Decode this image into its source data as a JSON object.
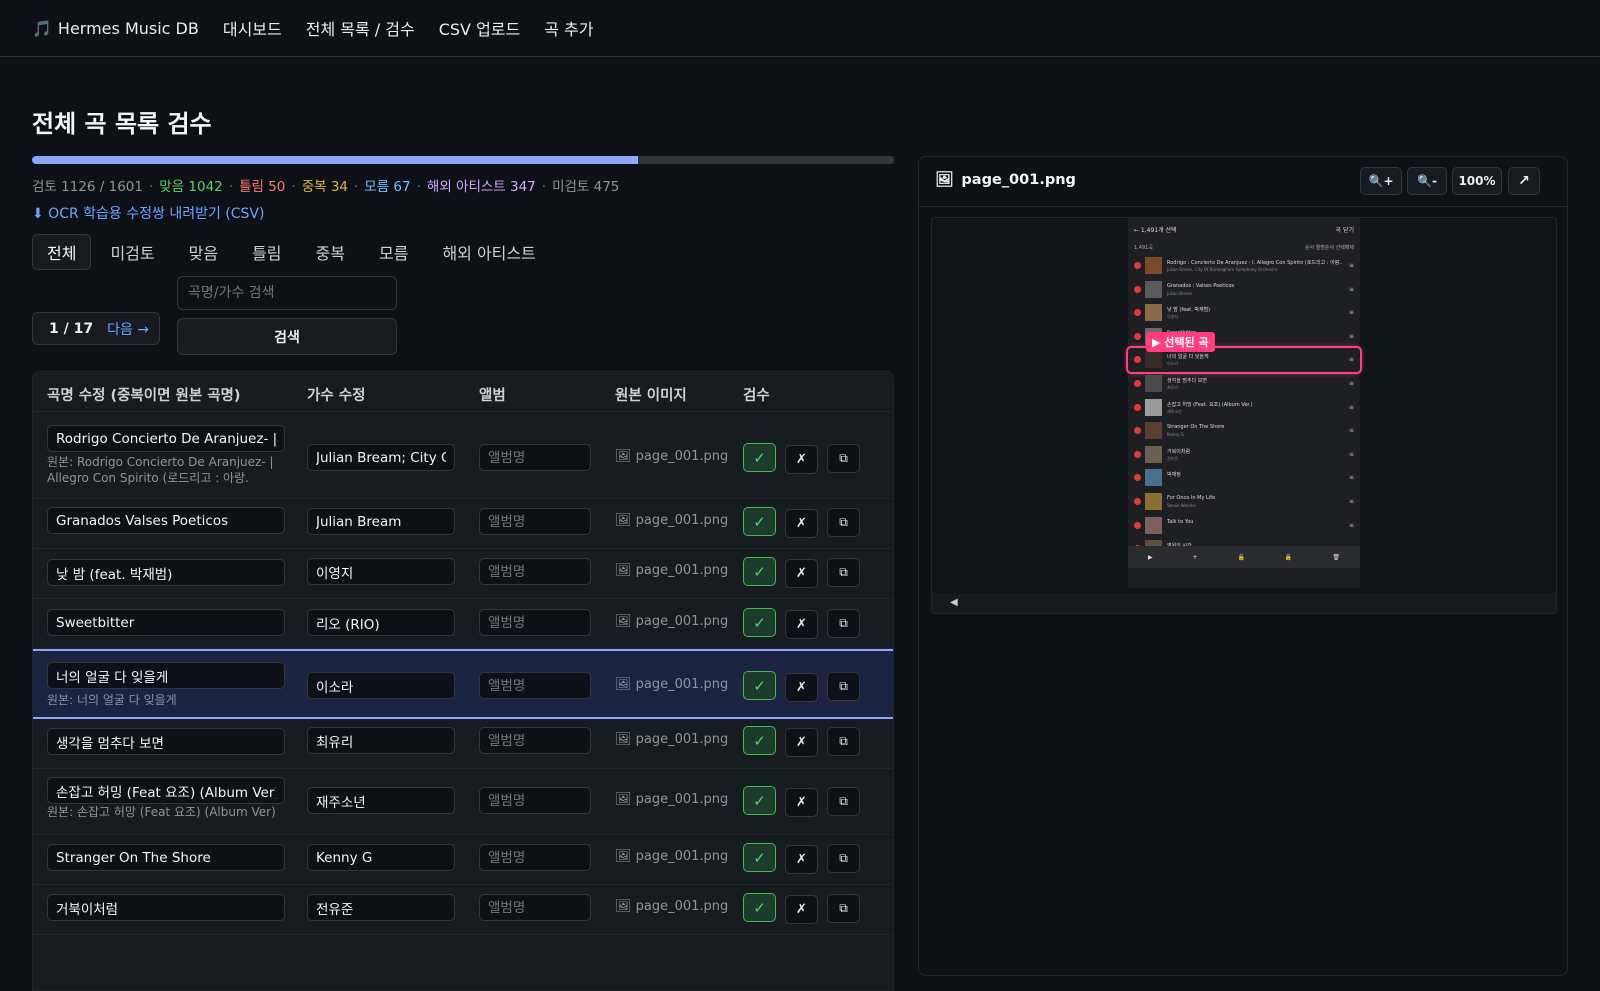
{
  "nav": {
    "brand_icon": "🎵",
    "brand": "Hermes Music DB",
    "links": [
      "대시보드",
      "전체 목록 / 검수",
      "CSV 업로드",
      "곡 추가"
    ]
  },
  "page": {
    "title": "전체 곡 목록 검수",
    "progress": 0.7033,
    "stats": {
      "review": "검토 1126 / 1601",
      "correct": "맞음 1042",
      "wrong": "틀림 50",
      "dup": "중복 34",
      "unknown": "모름 67",
      "foreign": "해외 아티스트 347",
      "unreviewed": "미검토 475"
    },
    "download_link": "⬇ OCR 학습용 수정쌍 내려받기 (CSV)",
    "filters": [
      "전체",
      "미검토",
      "맞음",
      "틀림",
      "중복",
      "모름",
      "해외 아티스트"
    ],
    "pager": {
      "page": "1 / 17",
      "next": "다음 →"
    },
    "search": {
      "placeholder": "곡명/가수 검색",
      "button": "검색"
    }
  },
  "table": {
    "headers": [
      "곡명 수정 (중복이면 원본 곡명)",
      "가수 수정",
      "앨범",
      "원본 이미지",
      "검수"
    ],
    "album_placeholder": "앨범명",
    "image_prefix": "🖼 ",
    "ok_icon": "✓",
    "x_icon": "✗",
    "dup_icon": "⧉",
    "rows": [
      {
        "title": "Rodrigo Concierto De Aranjuez- | Allegro Con Spirito",
        "artist": "Julian Bream; City Of",
        "orig": "원본: Rodrigo Concierto De Aranjuez- | Allegro Con Spirito (로드리고 : 아랑.",
        "image": "page_001.png"
      },
      {
        "title": "Granados Valses Poeticos",
        "artist": "Julian Bream",
        "orig": "",
        "image": "page_001.png"
      },
      {
        "title": "낮 밤 (feat. 박재범)",
        "artist": "이영지",
        "orig": "",
        "image": "page_001.png"
      },
      {
        "title": "Sweetbitter",
        "artist": "리오 (RIO)",
        "orig": "",
        "image": "page_001.png"
      },
      {
        "title": "너의 얼굴 다 잊을게",
        "artist": "이소라",
        "orig": "원본: 너의 얼굴 다 잊을게",
        "image": "page_001.png"
      },
      {
        "title": "생각을 멈추다 보면",
        "artist": "최유리",
        "orig": "",
        "image": "page_001.png"
      },
      {
        "title": "손잡고 허밍 (Feat 요조) (Album Ver)",
        "artist": "재주소년",
        "orig": "원본: 손잡고 허망 (Feat 요조) (Album Ver)",
        "image": "page_001.png"
      },
      {
        "title": "Stranger On The Shore",
        "artist": "Kenny G",
        "orig": "",
        "image": "page_001.png"
      },
      {
        "title": "거북이처럼",
        "artist": "전유준",
        "orig": "",
        "image": "page_001.png"
      }
    ]
  },
  "viewer": {
    "file_icon": "🖼",
    "filename": "page_001.png",
    "zoom_in": "🔍+",
    "zoom_out": "🔍-",
    "zoom": "100%",
    "open": "↗",
    "arrow_left": "◀",
    "phone": {
      "header_left": "← 1,491개 선택",
      "header_right": "곡 닫기",
      "sub_left": "1,491곡",
      "sub_right": "순서  앨범순서  선택해제",
      "selected_label": "▶ 선택된 곡",
      "bottom": [
        "▶",
        "+",
        "🔓",
        "🔒",
        "🗑"
      ],
      "songs": [
        {
          "t": "Rodrigo : Concierto De Aranjuez - I. Allegro Con Spirito (로드리고 : 아랑...",
          "s": "Julian Bream, City Of Birmingham Symphony Orchestra"
        },
        {
          "t": "Granados : Valses Poeticos",
          "s": "Julian Bream"
        },
        {
          "t": "낮 밤 (feat. 박재범)",
          "s": "이영지"
        },
        {
          "t": "Sweetbitter",
          "s": ""
        },
        {
          "t": "너의 얼굴 다 잊을게",
          "s": "이소라"
        },
        {
          "t": "생각을 멈추다 보면",
          "s": "최유리"
        },
        {
          "t": "손잡고 허밍 (Feat. 요조) (Album Ver.)",
          "s": "재주소년"
        },
        {
          "t": "Stranger On The Shore",
          "s": "Kenny G"
        },
        {
          "t": "거북이처럼",
          "s": "전유준"
        },
        {
          "t": "박재정",
          "s": ""
        },
        {
          "t": "For Once In My Life",
          "s": "Stevie Wonder"
        },
        {
          "t": "Talk to You",
          "s": ""
        },
        {
          "t": "영원의 시간",
          "s": ""
        }
      ]
    }
  }
}
